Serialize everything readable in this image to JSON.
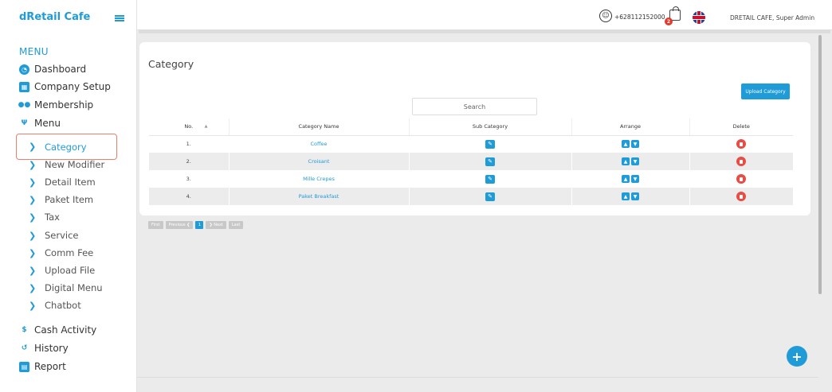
{
  "brand": "dRetail Cafe",
  "sidebar": {
    "menu_header": "MENU",
    "items": [
      {
        "label": "Dashboard",
        "icon": "dashboard-icon"
      },
      {
        "label": "Company Setup",
        "icon": "building-icon"
      },
      {
        "label": "Membership",
        "icon": "users-icon"
      },
      {
        "label": "Menu",
        "icon": "cutlery-icon"
      }
    ],
    "sub_items": [
      "Category",
      "New Modifier",
      "Detail Item",
      "Paket Item",
      "Tax",
      "Service",
      "Comm Fee",
      "Upload File",
      "Digital Menu",
      "Chatbot"
    ],
    "bottom_items": [
      {
        "label": "Cash Activity",
        "icon": "dollar-icon"
      },
      {
        "label": "History",
        "icon": "history-icon"
      },
      {
        "label": "Report",
        "icon": "file-icon"
      }
    ]
  },
  "topbar": {
    "phone": "+628112152000",
    "cart_count": "2",
    "user": "DRETAIL CAFE, Super Admin"
  },
  "page": {
    "title": "Category",
    "upload_label": "Upload Category",
    "search_placeholder": "Search"
  },
  "table": {
    "headers": [
      "No.",
      "Category Name",
      "Sub Category",
      "Arrange",
      "Delete"
    ],
    "rows": [
      {
        "no": "1.",
        "name": "Coffee"
      },
      {
        "no": "2.",
        "name": "Croisant"
      },
      {
        "no": "3.",
        "name": "Mille Crepes"
      },
      {
        "no": "4.",
        "name": "Paket Breakfast"
      }
    ]
  },
  "pagination": {
    "first": "First",
    "previous": "Previous ❮",
    "current": "1",
    "next": "❯ Next",
    "last": "Last"
  },
  "colors": {
    "accent": "#1f9bd8",
    "danger": "#e94c44"
  }
}
